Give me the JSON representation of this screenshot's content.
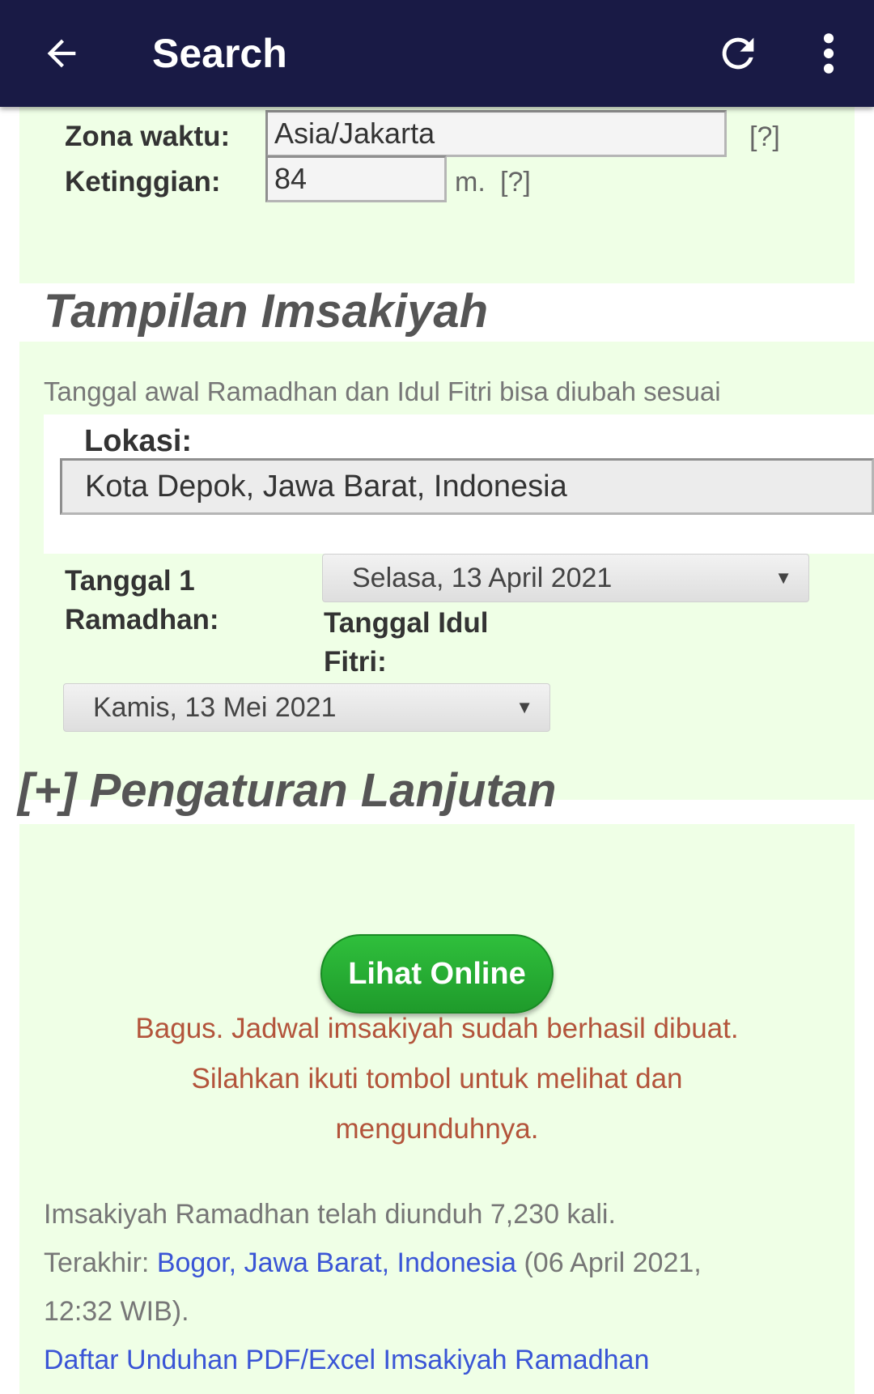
{
  "appbar": {
    "title": "Search",
    "back_icon": "arrow-left-icon",
    "refresh_icon": "refresh-icon",
    "menu_icon": "more-vertical-icon",
    "background": "#191a45"
  },
  "settings": {
    "timezone_label": "Zona waktu:",
    "timezone_value": "Asia/Jakarta",
    "timezone_help": "[?]",
    "elevation_label": "Ketinggian:",
    "elevation_value": "84",
    "elevation_unit": "m.",
    "elevation_help": "[?]"
  },
  "display_section": {
    "heading": "Tampilan Imsakiyah",
    "info": "Tanggal awal Ramadhan dan Idul Fitri bisa diubah sesuai",
    "location_label": "Lokasi:",
    "location_value": "Kota Depok, Jawa Barat, Indonesia",
    "ramadhan_label_line1": "Tanggal 1",
    "ramadhan_label_line2": "Ramadhan:",
    "ramadhan_value": "Selasa, 13 April 2021",
    "idul_fitri_label_line1": "Tanggal Idul",
    "idul_fitri_label_line2": "Fitri:",
    "idul_fitri_value": "Kamis, 13 Mei 2021"
  },
  "advanced_section": {
    "heading": "[+] Pengaturan Lanjutan"
  },
  "action": {
    "view_online_label": "Lihat Online",
    "success_line1": "Bagus. Jadwal imsakiyah sudah berhasil dibuat.",
    "success_line2": "Silahkan ikuti tombol untuk melihat dan",
    "success_line3": "mengunduhnya."
  },
  "stats": {
    "download_count_text": "Imsakiyah Ramadhan telah diunduh 7,230 kali.",
    "last_prefix": "Terakhir: ",
    "last_location": "Bogor, Jawa Barat, Indonesia",
    "last_time": " (06 April 2021,",
    "last_time_line2": "12:32 WIB).",
    "download_list_link": "Daftar Unduhan PDF/Excel Imsakiyah Ramadhan"
  },
  "colors": {
    "panel_green": "#efffe6",
    "button_green": "#25a832",
    "success_text": "#b3543b",
    "link_blue": "#3a55d6"
  }
}
